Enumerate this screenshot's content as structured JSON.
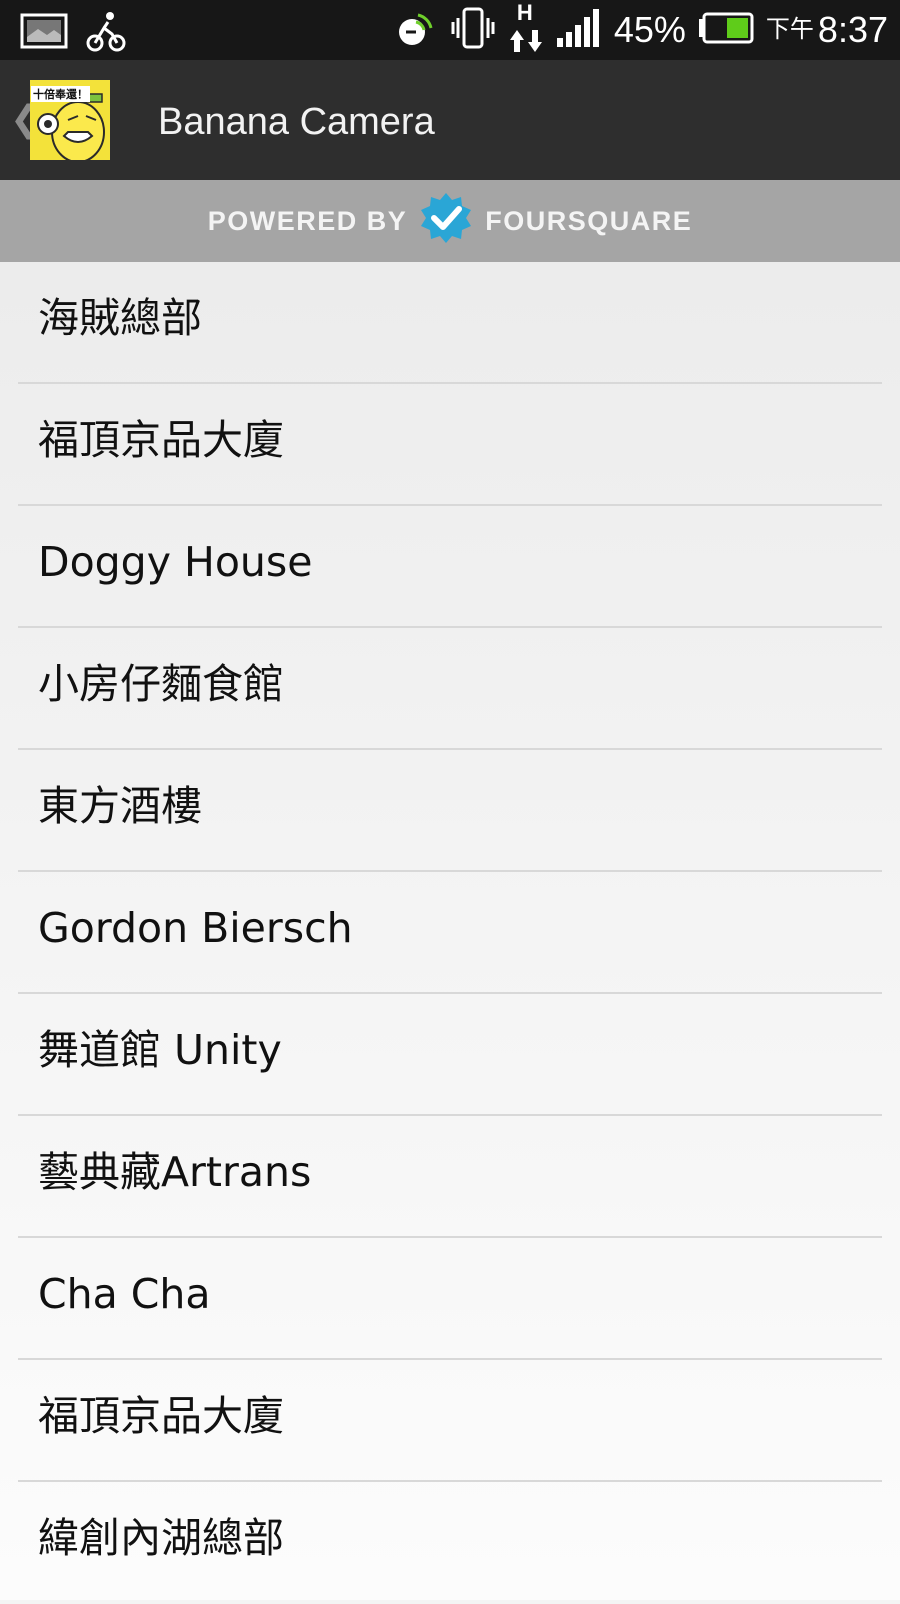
{
  "status_bar": {
    "battery_percent": "45%",
    "battery_level": 0.45,
    "ampm": "下午",
    "time": "8:37",
    "network_type": "H",
    "icons": [
      "gallery-icon",
      "cycling-icon",
      "nfc-icon",
      "vibrate-icon",
      "data-transfer-icon",
      "signal-icon",
      "battery-icon"
    ]
  },
  "action_bar": {
    "title": "Banana Camera",
    "app_icon_caption": "十倍奉還！"
  },
  "powered_banner": {
    "left_text": "POWERED BY",
    "right_text": "FOURSQUARE",
    "accent_color": "#2aa6d6"
  },
  "venues": [
    {
      "label": "海賊總部"
    },
    {
      "label": "福頂京品大廈"
    },
    {
      "label": "Doggy House"
    },
    {
      "label": "小房仔麵食館"
    },
    {
      "label": "東方酒樓"
    },
    {
      "label": "Gordon Biersch"
    },
    {
      "label": "舞道館 Unity"
    },
    {
      "label": "藝典藏Artrans"
    },
    {
      "label": "Cha Cha"
    },
    {
      "label": "福頂京品大廈"
    },
    {
      "label": "緯創內湖總部"
    }
  ]
}
